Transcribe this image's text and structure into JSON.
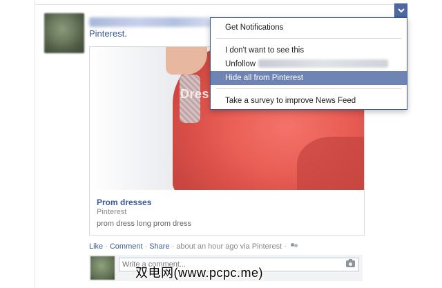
{
  "post": {
    "source_name": "Pinterest",
    "source_suffix": "."
  },
  "card": {
    "image_overlay_text": "Dres",
    "title": "Prom dresses",
    "source": "Pinterest",
    "description": "prom dress long prom dress"
  },
  "actions": {
    "like": "Like",
    "comment": "Comment",
    "share": "Share",
    "separator": "·",
    "meta": "about an hour ago via Pinterest",
    "friends_icon": "friends-icon"
  },
  "comment_box": {
    "placeholder": "Write a comment..."
  },
  "menu": {
    "items": [
      {
        "label": "Get Notifications"
      },
      {
        "label": "I don't want to see this"
      },
      {
        "label": "Unfollow"
      },
      {
        "label": "Hide all from Pinterest"
      },
      {
        "label": "Take a survey to improve News Feed"
      }
    ]
  },
  "watermark": "双电网(www.pcpc.me)",
  "colors": {
    "link": "#3b5998",
    "menu_selected": "#6d84b4",
    "chevron_button": "#4e69a2"
  }
}
